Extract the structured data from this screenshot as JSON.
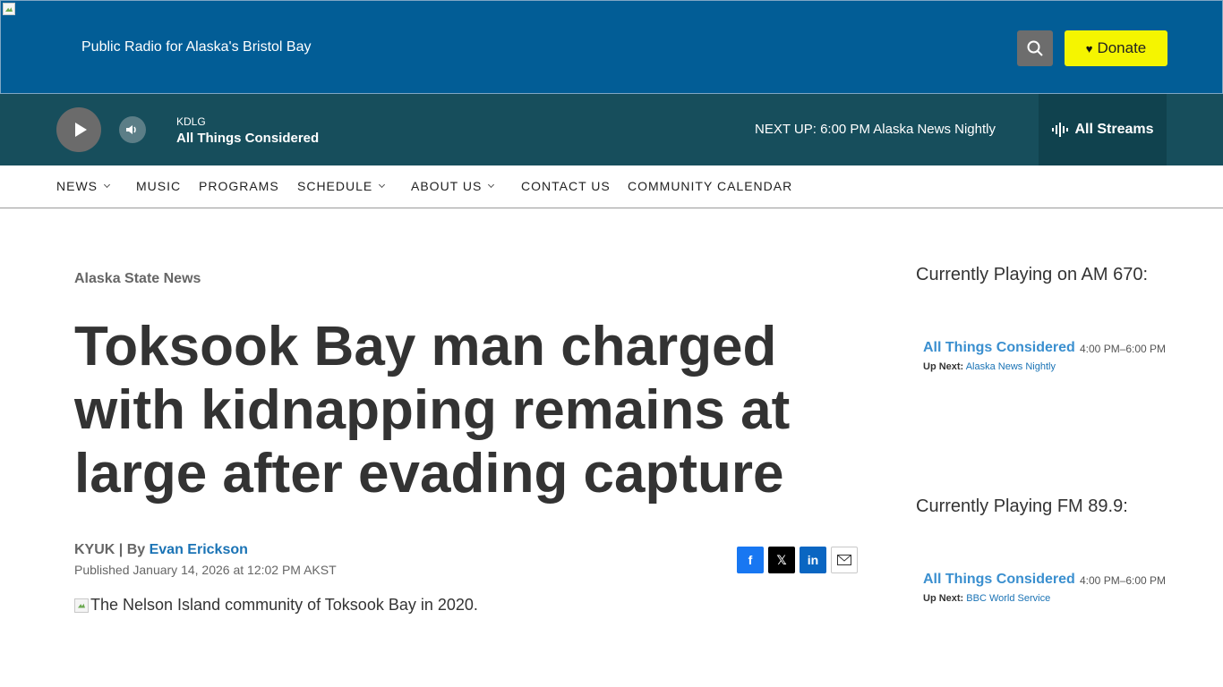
{
  "header": {
    "tagline": "Public Radio for Alaska's Bristol Bay",
    "search_icon": "search-icon",
    "donate_label": "Donate"
  },
  "player": {
    "station": "KDLG",
    "show": "All Things Considered",
    "next_up": "NEXT UP: 6:00 PM Alaska News Nightly",
    "streams_label": "All Streams"
  },
  "nav": {
    "items": [
      {
        "label": "NEWS",
        "dropdown": true
      },
      {
        "label": "MUSIC",
        "dropdown": false
      },
      {
        "label": "PROGRAMS",
        "dropdown": false
      },
      {
        "label": "SCHEDULE",
        "dropdown": true
      },
      {
        "label": "ABOUT US",
        "dropdown": true
      },
      {
        "label": "CONTACT US",
        "dropdown": false
      },
      {
        "label": "COMMUNITY CALENDAR",
        "dropdown": false
      }
    ]
  },
  "article": {
    "category": "Alaska State News",
    "headline": "Toksook Bay man charged with kidnapping remains at large after evading capture",
    "source": "KYUK | By ",
    "author": "Evan Erickson",
    "published": "Published January 14, 2026 at 12:02 PM AKST",
    "image_alt": "The Nelson Island community of Toksook Bay in 2020."
  },
  "share": {
    "facebook": "f",
    "x": "𝕏",
    "linkedin": "in"
  },
  "sidebar": {
    "am": {
      "heading": "Currently Playing on AM 670:",
      "title": "All Things Considered",
      "time": "4:00 PM–6:00 PM",
      "up_next_label": "Up Next:",
      "up_next": "Alaska News Nightly"
    },
    "fm": {
      "heading": "Currently Playing FM 89.9:",
      "title": "All Things Considered",
      "time": "4:00 PM–6:00 PM",
      "up_next_label": "Up Next:",
      "up_next": "BBC World Service"
    }
  },
  "colors": {
    "header_bg": "#025d96",
    "player_bg": "#174e5c",
    "donate_bg": "#f5f500",
    "link": "#1a73b5"
  }
}
